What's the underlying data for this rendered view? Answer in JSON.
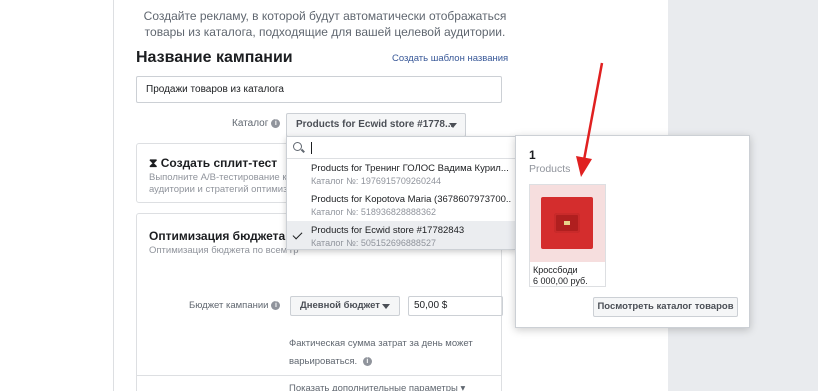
{
  "intro_text": "Создайте рекламу, в которой будут автоматически отображаться товары из каталога, подходящие для вашей целевой аудитории.",
  "campaign": {
    "title": "Название кампании",
    "template_link": "Создать шаблон названия",
    "name_value": "Продажи товаров из каталога"
  },
  "catalog": {
    "label": "Каталог",
    "selected": "Products for Ecwid store #1778...",
    "search_value": "",
    "options": [
      {
        "name": "Products for Тренинг ГОЛОС Вадима Курил...",
        "id": "Каталог №: 1976915709260244",
        "selected": false
      },
      {
        "name": "Products for Kopotova Maria (3678607973700...",
        "id": "Каталог №: 518936828888362",
        "selected": false
      },
      {
        "name": "Products for Ecwid store #17782843",
        "id": "Каталог №: 505152696888527",
        "selected": true
      }
    ]
  },
  "split_test": {
    "title": "Создать сплит-тест",
    "desc_line1": "Выполните A/B-тестирование кре",
    "desc_line2": "аудитории и стратегий оптимиза"
  },
  "budget": {
    "title": "Оптимизация бюджета кам",
    "subtitle": "Оптимизация бюджета по всем гр",
    "label": "Бюджет кампании",
    "type": "Дневной бюджет",
    "amount": "50,00 $",
    "note": "Фактическая сумма затрат за день может варьироваться.",
    "more_params": "Показать дополнительные параметры ▾"
  },
  "preview": {
    "count": "1",
    "count_label": "Products",
    "product_name": "Кроссбоди",
    "product_price": "6 000,00 руб.",
    "view_button": "Посмотреть каталог товаров"
  },
  "colors": {
    "link": "#385898",
    "arrow": "#e02020",
    "product_accent": "#d42d2d"
  }
}
